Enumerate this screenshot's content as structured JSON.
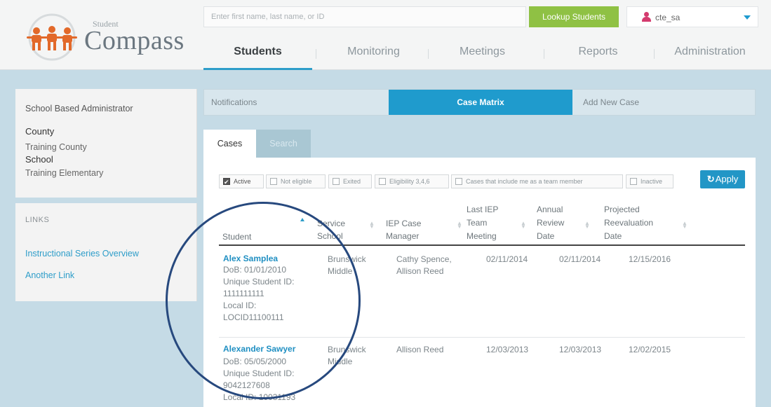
{
  "header": {
    "logo_small": "Student",
    "logo_big": "Compass",
    "search_placeholder": "Enter first name, last name, or ID",
    "lookup_label": "Lookup Students",
    "user_name": "cte_sa"
  },
  "nav": [
    "Students",
    "Monitoring",
    "Meetings",
    "Reports",
    "Administration"
  ],
  "sidebar": {
    "role": "School Based Administrator",
    "county_label": "County",
    "county_value": "Training County",
    "school_label": "School",
    "school_value": "Training Elementary",
    "links_title": "LINKS",
    "links": [
      "Instructional Series Overview",
      "Another Link"
    ]
  },
  "main_tabs": [
    "Notifications",
    "Case Matrix",
    "Add New Case"
  ],
  "sub_tabs": [
    "Cases",
    "Search"
  ],
  "filters": [
    "Active",
    "Not eligible",
    "Exited",
    "Eligibility 3,4,6",
    "Cases that include me as a team member",
    "Inactive"
  ],
  "apply_label": "Apply",
  "columns": {
    "student": "Student",
    "service_school_1": "Service",
    "service_school_2": "School",
    "manager_1": "IEP Case",
    "manager_2": "Manager",
    "last_iep_1": "Last IEP",
    "last_iep_2": "Team",
    "last_iep_3": "Meeting",
    "annual_1": "Annual",
    "annual_2": "Review",
    "annual_3": "Date",
    "reeval_1": "Projected",
    "reeval_2": "Reevaluation",
    "reeval_3": "Date"
  },
  "rows": [
    {
      "name": "Alex Samplea",
      "dob": "DoB: 01/01/2010",
      "uid_label": "Unique Student ID:",
      "uid": "1111111111",
      "local_label": "Local ID:",
      "local": "LOCID11100111",
      "school_1": "Brunswick",
      "school_2": "Middle",
      "manager_1": "Cathy Spence,",
      "manager_2": "Allison Reed",
      "last_iep": "02/11/2014",
      "annual": "02/11/2014",
      "reeval": "12/15/2016"
    },
    {
      "name": "Alexander Sawyer",
      "dob": "DoB: 05/05/2000",
      "uid_label": "Unique Student ID:",
      "uid": "9042127608",
      "local_label": "Local ID: 10031193",
      "school_1": "Brunswick",
      "school_2": "Middle",
      "manager_1": "Allison Reed",
      "last_iep": "12/03/2013",
      "annual": "12/03/2013",
      "reeval": "12/02/2015"
    }
  ],
  "colors": {
    "accent": "#1f9bcd",
    "lookup": "#8fc144",
    "annotation_circle": "#27497e"
  }
}
